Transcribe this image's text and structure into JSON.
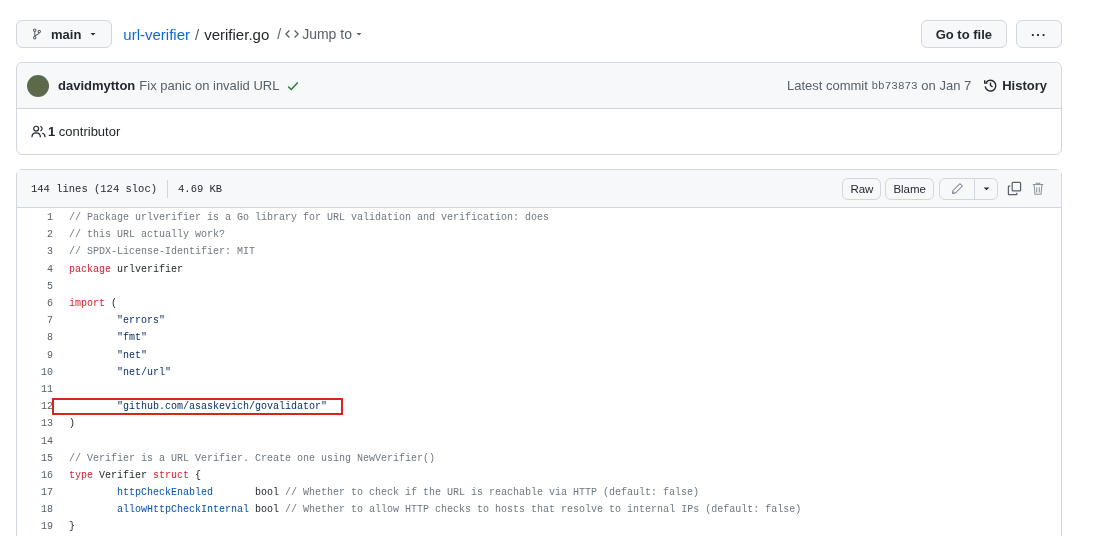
{
  "breadcrumb": {
    "branch": "main",
    "repo": "url-verifier",
    "separator": "/",
    "file": "verifier.go",
    "jump": "Jump to"
  },
  "actions": {
    "go_to_file": "Go to file",
    "more": "···"
  },
  "commit": {
    "author": "davidmytton",
    "message": "Fix panic on invalid URL",
    "checks_passed": true,
    "latest_label": "Latest commit",
    "sha": "bb73873",
    "date": "on Jan 7",
    "history": "History"
  },
  "contributors": {
    "count": "1",
    "label": "contributor"
  },
  "file": {
    "lines_info": "144 lines (124 sloc)",
    "size": "4.69 KB",
    "buttons": [
      "Raw",
      "Blame"
    ]
  },
  "code": [
    {
      "number": "1",
      "highlighted": false,
      "indented": false,
      "tokens": [
        {
          "kind": "comment",
          "text": "// Package urlverifier is a Go library for URL validation and verification: does"
        }
      ]
    },
    {
      "number": "2",
      "highlighted": false,
      "indented": false,
      "tokens": [
        {
          "kind": "comment",
          "text": "// this URL actually work?"
        }
      ]
    },
    {
      "number": "3",
      "highlighted": false,
      "indented": false,
      "tokens": [
        {
          "kind": "comment",
          "text": "// SPDX-License-Identifier: MIT"
        }
      ]
    },
    {
      "number": "4",
      "highlighted": false,
      "indented": false,
      "tokens": [
        {
          "kind": "keyword",
          "text": "package"
        },
        {
          "kind": "plain",
          "text": " urlverifier"
        }
      ]
    },
    {
      "number": "5"
    },
    {
      "number": "6",
      "highlighted": false,
      "indented": false,
      "tokens": [
        {
          "kind": "keyword",
          "text": "import"
        },
        {
          "kind": "plain",
          "text": " ("
        }
      ]
    },
    {
      "number": "7",
      "highlighted": false,
      "indented": true,
      "tokens": [
        {
          "kind": "string",
          "text": "\"errors\""
        }
      ]
    },
    {
      "number": "8",
      "highlighted": false,
      "indented": true,
      "tokens": [
        {
          "kind": "string",
          "text": "\"fmt\""
        }
      ]
    },
    {
      "number": "9",
      "highlighted": false,
      "indented": true,
      "tokens": [
        {
          "kind": "string",
          "text": "\"net\""
        }
      ]
    },
    {
      "number": "10",
      "highlighted": false,
      "indented": true,
      "tokens": [
        {
          "kind": "string",
          "text": "\"net/url\""
        }
      ]
    },
    {
      "number": "11"
    },
    {
      "number": "12",
      "highlighted": true,
      "indented": true,
      "tokens": [
        {
          "kind": "string",
          "text": "\"github.com/asaskevich/govalidator\""
        }
      ]
    },
    {
      "number": "13",
      "highlighted": false,
      "indented": false,
      "tokens": [
        {
          "kind": "plain",
          "text": ")"
        }
      ]
    },
    {
      "number": "14"
    },
    {
      "number": "15",
      "highlighted": false,
      "indented": false,
      "tokens": [
        {
          "kind": "comment",
          "text": "// Verifier is a URL Verifier. Create one using NewVerifier()"
        }
      ]
    },
    {
      "number": "16",
      "highlighted": false,
      "indented": false,
      "tokens": [
        {
          "kind": "keyword",
          "text": "type"
        },
        {
          "kind": "plain",
          "text": " Verifier "
        },
        {
          "kind": "keyword",
          "text": "struct"
        },
        {
          "kind": "plain",
          "text": " {"
        }
      ]
    },
    {
      "number": "17",
      "highlighted": false,
      "indented": true,
      "tokens": [
        {
          "kind": "ident",
          "text": "httpCheckEnabled"
        },
        {
          "kind": "plain",
          "text": "       bool "
        },
        {
          "kind": "comment",
          "text": "// Whether to check if the URL is reachable via HTTP (default: false)"
        }
      ]
    },
    {
      "number": "18",
      "highlighted": false,
      "indented": true,
      "tokens": [
        {
          "kind": "ident",
          "text": "allowHttpCheckInternal"
        },
        {
          "kind": "plain",
          "text": " bool "
        },
        {
          "kind": "comment",
          "text": "// Whether to allow HTTP checks to hosts that resolve to internal IPs (default: false)"
        }
      ]
    },
    {
      "number": "19",
      "highlighted": false,
      "indented": false,
      "tokens": [
        {
          "kind": "plain",
          "text": "}"
        }
      ]
    }
  ]
}
